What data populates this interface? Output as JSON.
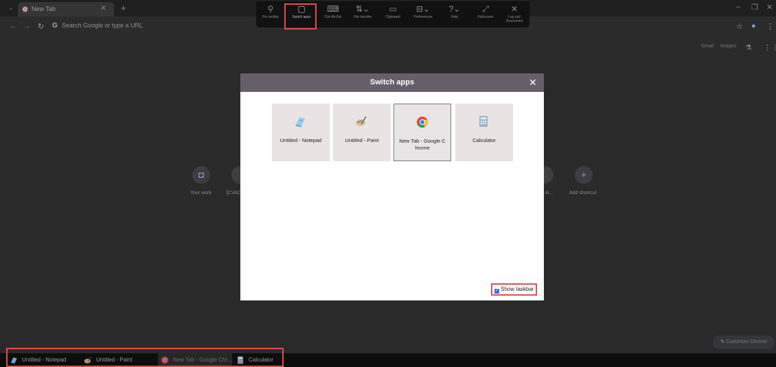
{
  "browser": {
    "tab_title": "New Tab",
    "omnibox_placeholder": "Search Google or type a URL",
    "omnibox_g": "G"
  },
  "remote_toolbar": {
    "items": [
      {
        "label": "Pin toolbar",
        "icon": "pin-icon"
      },
      {
        "label": "Switch apps",
        "icon": "switch-apps-icon"
      },
      {
        "label": "Ctrl-Alt-Del",
        "icon": "ctrl-alt-del-icon"
      },
      {
        "label": "File transfer",
        "icon": "file-transfer-icon"
      },
      {
        "label": "Clipboard",
        "icon": "clipboard-icon"
      },
      {
        "label": "Preferences",
        "icon": "preferences-icon"
      },
      {
        "label": "Help",
        "icon": "help-icon"
      },
      {
        "label": "Fullscreen",
        "icon": "fullscreen-icon"
      },
      {
        "label": "Log out/\nDisconnect",
        "icon": "logout-icon"
      }
    ]
  },
  "ntp": {
    "gmail": "Gmail",
    "images": "Images",
    "shortcuts": [
      {
        "label": "Your work"
      },
      {
        "label": "[CVAC"
      },
      {
        "label": "t A..."
      },
      {
        "label": "Add shortcut"
      }
    ],
    "customize_label": "Customize Chrome"
  },
  "dialog": {
    "title": "Switch apps",
    "apps": [
      {
        "label": "Untitled - Notepad",
        "icon": "notepad-icon"
      },
      {
        "label": "Untitled - Paint",
        "icon": "paint-icon"
      },
      {
        "label": "New Tab - Google C hrome",
        "icon": "chrome-icon",
        "selected": true
      },
      {
        "label": "Calculator",
        "icon": "calculator-icon"
      }
    ],
    "show_taskbar_label": "Show taskbar",
    "show_taskbar_checked": true
  },
  "taskbar": {
    "items": [
      {
        "label": "Untitled - Notepad",
        "icon": "notepad-icon"
      },
      {
        "label": "Untitled - Paint",
        "icon": "paint-icon"
      },
      {
        "label": "New Tab - Google Chr...",
        "icon": "chrome-icon",
        "active": true
      },
      {
        "label": "Calculator",
        "icon": "calculator-icon"
      }
    ]
  },
  "colors": {
    "dialog_header": "#675e6c",
    "highlight": "#e05050",
    "checkbox": "#3173d8"
  }
}
